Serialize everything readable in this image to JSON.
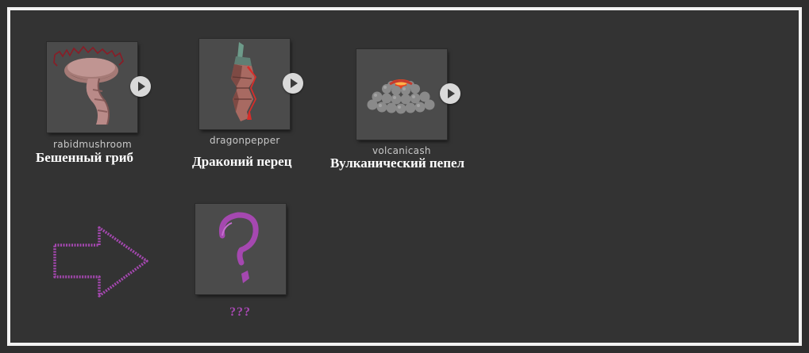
{
  "items": [
    {
      "asset_name": "rabidmushroom",
      "title": "Бешенный гриб",
      "icon": "mushroom-icon"
    },
    {
      "asset_name": "dragonpepper",
      "title": "Драконий перец",
      "icon": "pepper-icon"
    },
    {
      "asset_name": "volcanicash",
      "title": "Вулканический пепел",
      "icon": "volcanic-ash-icon"
    }
  ],
  "result": {
    "title": "???",
    "icon": "question-mark-icon"
  },
  "arrow": {
    "icon": "arrow-right-icon",
    "color": "#a548b0"
  },
  "colors": {
    "background": "#333333",
    "border": "#f2f2f2",
    "accent": "#a548b0"
  }
}
